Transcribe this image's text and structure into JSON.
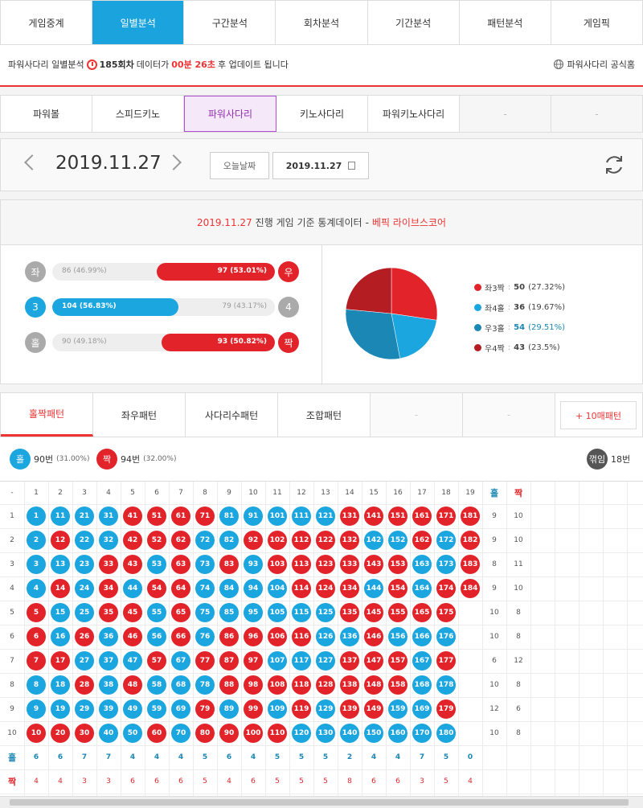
{
  "topnav": [
    "게임중계",
    "일별분석",
    "구간분석",
    "회차분석",
    "기간분석",
    "패턴분석",
    "게임픽"
  ],
  "info": {
    "title": "파워사다리 일별분석",
    "round": "185회차",
    "mid": "데이터가",
    "time": "00분 26초",
    "tail": "후 업데이트 됩니다",
    "official": "파워사다리 공식홈"
  },
  "subnav": [
    "파워볼",
    "스피드키노",
    "파워사다리",
    "키노사다리",
    "파워키노사다리",
    "-",
    "-"
  ],
  "date": {
    "value": "2019.11.27",
    "today": "오늘날짜",
    "input": "2019.11.27"
  },
  "stats_head": {
    "date": "2019.11.27",
    "text": "진행 게임 기준 통계데이터",
    "dash": "-",
    "brand": "베픽 라이브스코어"
  },
  "bars": [
    {
      "left": "좌",
      "right": "우",
      "left_val": "86 (46.99%)",
      "right_val": "97 (53.01%)",
      "left_frac": 0.4699,
      "winner": "right",
      "color": "#e2242a"
    },
    {
      "left": "3",
      "right": "4",
      "left_val": "104 (56.83%)",
      "right_val": "79 (43.17%)",
      "left_frac": 0.5683,
      "winner": "left",
      "color": "#1ba6e0"
    },
    {
      "left": "홀",
      "right": "짝",
      "left_val": "90 (49.18%)",
      "right_val": "93 (50.82%)",
      "left_frac": 0.4918,
      "winner": "right",
      "color": "#e2242a"
    }
  ],
  "legend": [
    {
      "label": "좌3짝",
      "sep": ":",
      "value": "50",
      "pct": "(27.32%)",
      "color": "#e2242a"
    },
    {
      "label": "좌4홀",
      "sep": ":",
      "value": "36",
      "pct": "(19.67%)",
      "color": "#1ba6e0"
    },
    {
      "label": "우3홀",
      "sep": ":",
      "value": "54",
      "pct": "(29.51%)",
      "color": "#1b87b5"
    },
    {
      "label": "우4짝",
      "sep": ":",
      "value": "43",
      "pct": "(23.5%)",
      "color": "#b41e23"
    }
  ],
  "pattern_tabs": [
    "홀짝패턴",
    "좌우패턴",
    "사다리수패턴",
    "조합패턴",
    "-",
    "-"
  ],
  "ten_button": "+ 10매패턴",
  "summary": {
    "odd_label": "홀",
    "odd_count": "90번",
    "odd_pct": "(31.00%)",
    "even_label": "짝",
    "even_count": "94번",
    "even_pct": "(32.00%)",
    "break_label": "꺾임",
    "break_count": "18번"
  },
  "grid": {
    "corner": "-",
    "col_head": [
      "1",
      "2",
      "3",
      "4",
      "5",
      "6",
      "7",
      "8",
      "9",
      "10",
      "11",
      "12",
      "13",
      "14",
      "15",
      "16",
      "17",
      "18",
      "19"
    ],
    "odd_head": "홀",
    "even_head": "짝",
    "row_head": [
      "1",
      "2",
      "3",
      "4",
      "5",
      "6",
      "7",
      "8",
      "9",
      "10"
    ],
    "cells": [
      [
        "o",
        "o",
        "o",
        "o",
        "e",
        "e",
        "e",
        "e",
        "o",
        "o",
        "o",
        "o",
        "o",
        "e",
        "e",
        "e",
        "e",
        "e",
        "e"
      ],
      [
        "o",
        "e",
        "o",
        "o",
        "e",
        "e",
        "e",
        "o",
        "o",
        "e",
        "e",
        "e",
        "e",
        "e",
        "o",
        "o",
        "e",
        "o",
        "e"
      ],
      [
        "o",
        "o",
        "o",
        "e",
        "e",
        "o",
        "e",
        "o",
        "e",
        "o",
        "e",
        "e",
        "e",
        "e",
        "e",
        "e",
        "o",
        "o",
        "e"
      ],
      [
        "o",
        "e",
        "o",
        "e",
        "o",
        "e",
        "e",
        "o",
        "o",
        "o",
        "o",
        "e",
        "e",
        "e",
        "o",
        "e",
        "o",
        "e",
        "e"
      ],
      [
        "e",
        "o",
        "o",
        "e",
        "e",
        "o",
        "e",
        "o",
        "o",
        "o",
        "o",
        "o",
        "o",
        "e",
        "e",
        "e",
        "e",
        "e",
        ""
      ],
      [
        "e",
        "o",
        "e",
        "o",
        "e",
        "o",
        "e",
        "o",
        "e",
        "e",
        "e",
        "e",
        "o",
        "o",
        "e",
        "o",
        "o",
        "o",
        ""
      ],
      [
        "e",
        "e",
        "o",
        "o",
        "o",
        "e",
        "o",
        "e",
        "e",
        "e",
        "o",
        "o",
        "o",
        "e",
        "e",
        "e",
        "o",
        "e",
        ""
      ],
      [
        "o",
        "o",
        "e",
        "o",
        "e",
        "o",
        "o",
        "o",
        "e",
        "e",
        "e",
        "e",
        "e",
        "e",
        "e",
        "e",
        "o",
        "o",
        ""
      ],
      [
        "o",
        "o",
        "o",
        "o",
        "o",
        "o",
        "o",
        "e",
        "o",
        "e",
        "o",
        "e",
        "o",
        "e",
        "e",
        "o",
        "o",
        "e",
        ""
      ],
      [
        "e",
        "e",
        "e",
        "o",
        "o",
        "e",
        "o",
        "e",
        "e",
        "e",
        "e",
        "o",
        "o",
        "o",
        "o",
        "o",
        "o",
        "o",
        ""
      ]
    ],
    "row_odd": [
      "9",
      "9",
      "8",
      "9",
      "10",
      "10",
      "6",
      "10",
      "12",
      "10"
    ],
    "row_even": [
      "10",
      "10",
      "11",
      "10",
      "8",
      "8",
      "12",
      "8",
      "6",
      "8"
    ],
    "foot_odd_label": "홀",
    "foot_even_label": "짝",
    "col_odd": [
      "6",
      "6",
      "7",
      "7",
      "4",
      "4",
      "4",
      "5",
      "6",
      "4",
      "5",
      "5",
      "5",
      "2",
      "4",
      "4",
      "7",
      "5",
      "0"
    ],
    "col_even": [
      "4",
      "4",
      "3",
      "3",
      "6",
      "6",
      "6",
      "5",
      "4",
      "6",
      "5",
      "5",
      "5",
      "8",
      "6",
      "6",
      "3",
      "5",
      "4"
    ]
  },
  "pie_data": {
    "type": "pie",
    "slices": [
      {
        "label": "좌3짝",
        "value": 50
      },
      {
        "label": "좌4홀",
        "value": 36
      },
      {
        "label": "우3홀",
        "value": 54
      },
      {
        "label": "우4짝",
        "value": 43
      }
    ]
  }
}
